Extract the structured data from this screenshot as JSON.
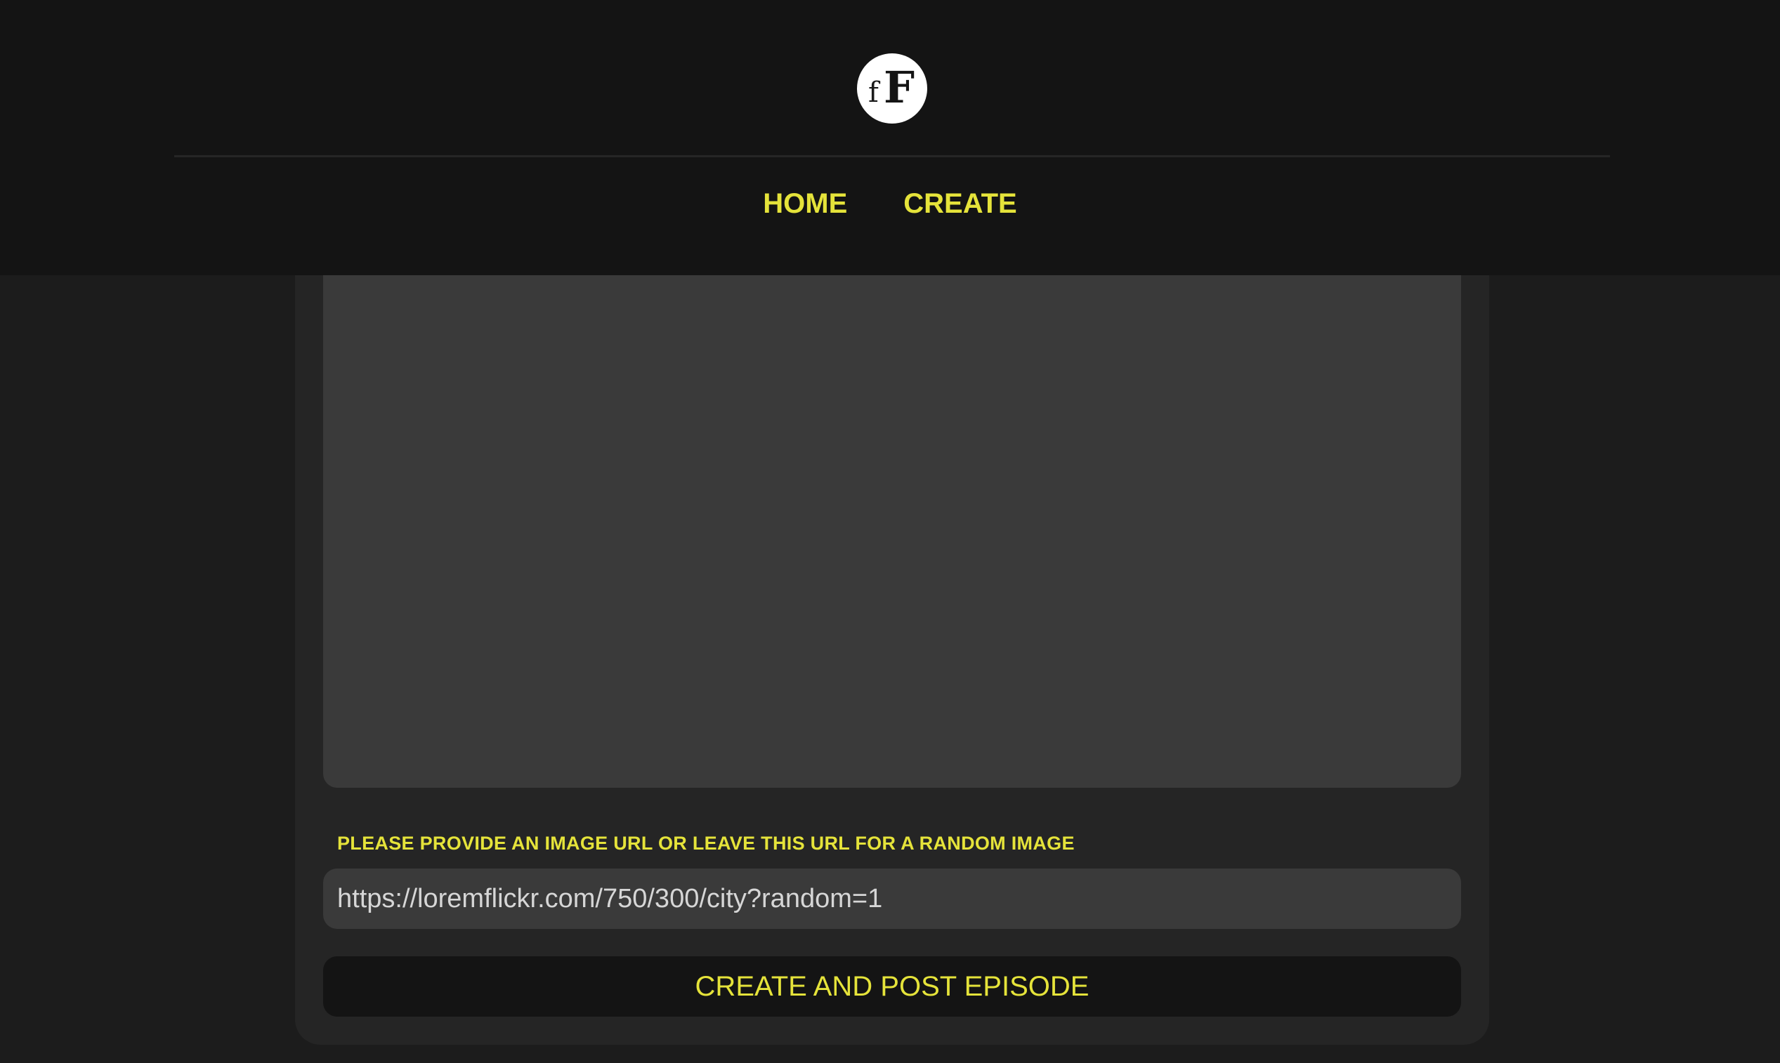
{
  "header": {
    "logo": {
      "small_letter": "f",
      "big_letter": "F"
    },
    "nav": {
      "home_label": "HOME",
      "create_label": "CREATE"
    }
  },
  "form": {
    "url_label": "PLEASE PROVIDE AN IMAGE URL OR LEAVE THIS URL FOR A RANDOM IMAGE",
    "url_value": "https://loremflickr.com/750/300/city?random=1",
    "submit_label": "CREATE AND POST EPISODE"
  },
  "colors": {
    "accent": "#e5e33a",
    "header_bg": "#141414",
    "page_bg": "#1c1c1c",
    "card_bg": "#252525",
    "input_bg": "#3a3a3a"
  }
}
